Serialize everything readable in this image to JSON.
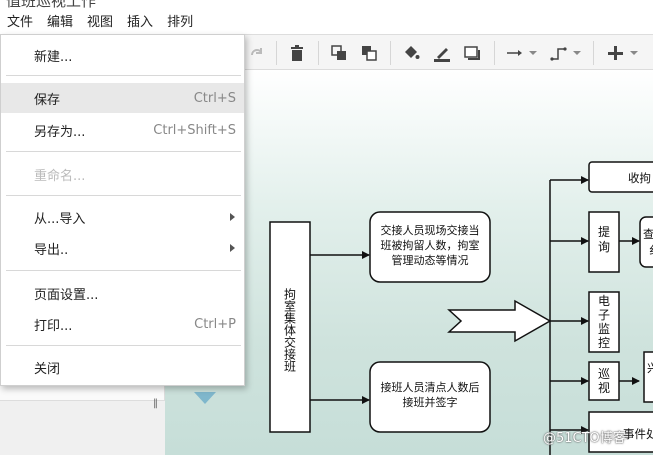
{
  "window": {
    "title": "值班巡视工作"
  },
  "menubar": {
    "items": [
      "文件",
      "编辑",
      "视图",
      "插入",
      "排列"
    ]
  },
  "file_menu": {
    "new": "新建...",
    "save": "保存",
    "save_shortcut": "Ctrl+S",
    "save_as": "另存为...",
    "save_as_shortcut": "Ctrl+Shift+S",
    "rename": "重命名...",
    "import_from": "从...导入",
    "export_as": "导出..",
    "page_setup": "页面设置...",
    "print": "打印...",
    "print_shortcut": "Ctrl+P",
    "close": "关闭"
  },
  "diagram": {
    "vertical_box": "拘室集体交接班",
    "box_handover_line1": "交接人员现场交接当",
    "box_handover_line2": "班被拘留人数，拘室",
    "box_handover_line3": "管理动态等情况",
    "box_receive_line1": "接班人员清点人数后",
    "box_receive_line2": "接班并签字",
    "box_top_right": "收拘",
    "box_tixun": "提询",
    "box_monitor": "电子监控",
    "box_patrol": "巡视",
    "box_partial_1": "查",
    "box_partial_2": "纟",
    "box_partial_3": "兴",
    "box_partial_4": "事件处"
  },
  "watermark": "@51CTO博客",
  "colors": {
    "highlight": "#e8e8e8",
    "canvas_top": "#ffffff",
    "canvas_bottom": "#c6ded8",
    "toolbar": "#f5f5f5"
  },
  "icons": [
    "redo-icon",
    "delete-icon",
    "to-front-icon",
    "to-back-icon",
    "fill-color-icon",
    "line-color-icon",
    "shadow-icon",
    "connection-icon",
    "waypoints-icon",
    "insert-plus-icon"
  ]
}
